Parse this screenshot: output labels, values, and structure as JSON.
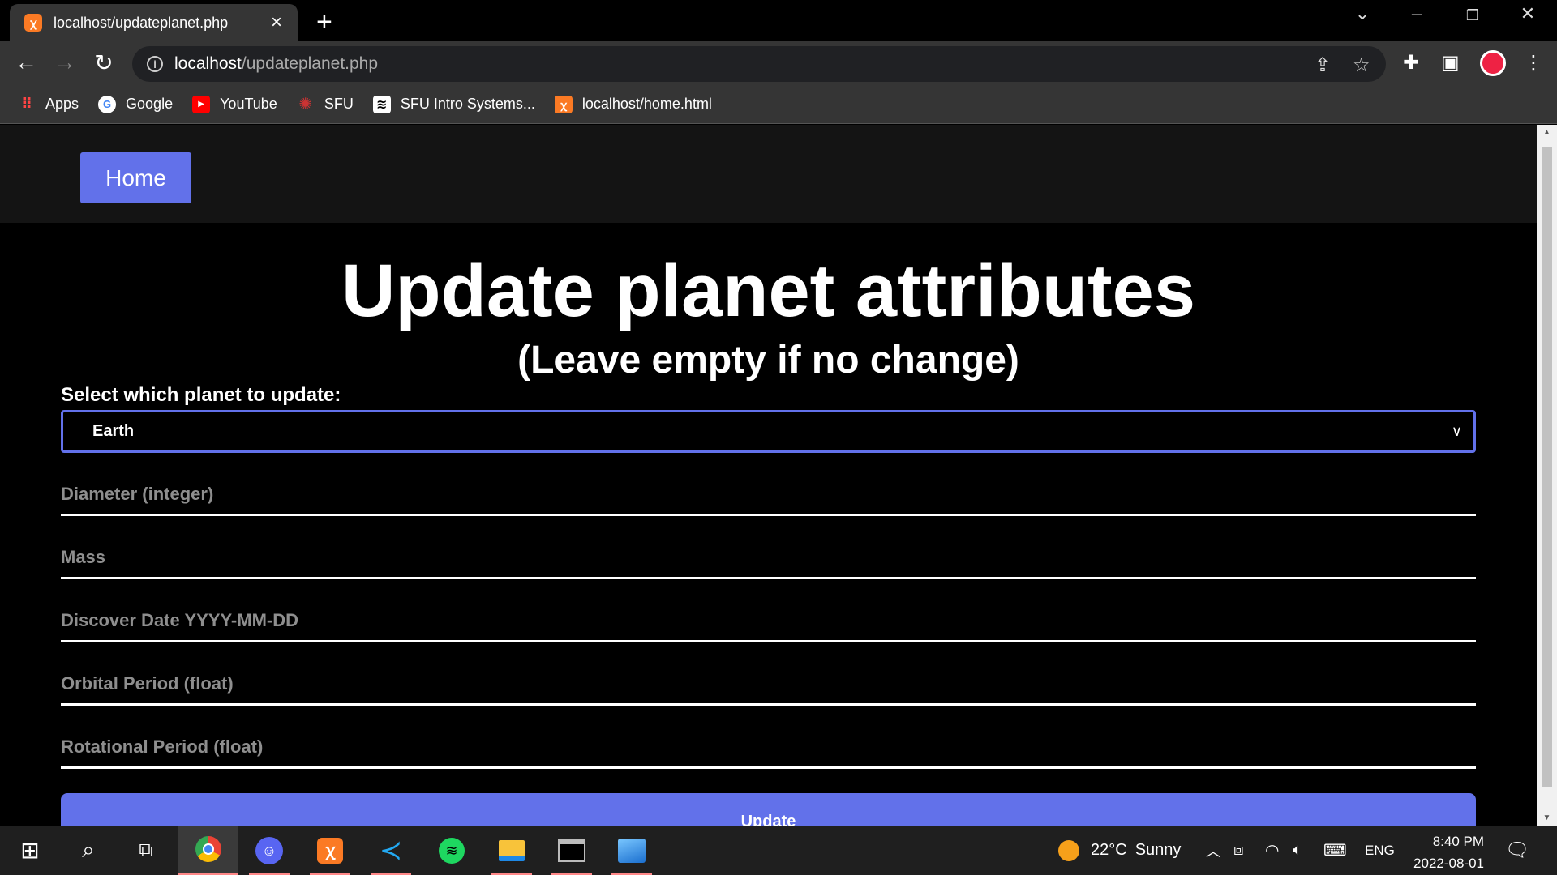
{
  "browser": {
    "tab_title": "localhost/updateplanet.php",
    "url_host": "localhost",
    "url_path": "/updateplanet.php",
    "bookmarks": [
      {
        "label": "Apps",
        "icon": "apps-grid-icon"
      },
      {
        "label": "Google",
        "icon": "google-icon"
      },
      {
        "label": "YouTube",
        "icon": "youtube-icon"
      },
      {
        "label": "SFU",
        "icon": "sfu-icon"
      },
      {
        "label": "SFU Intro Systems...",
        "icon": "sfu-intro-icon"
      },
      {
        "label": "localhost/home.html",
        "icon": "xampp-icon"
      }
    ]
  },
  "page": {
    "home_label": "Home",
    "title": "Update planet attributes",
    "subtitle": "(Leave empty if no change)",
    "select_label": "Select which planet to update:",
    "selected_planet": "Earth",
    "fields": {
      "diameter": "Diameter (integer)",
      "mass": "Mass",
      "discover_date": "Discover Date YYYY-MM-DD",
      "orbital_period": "Orbital Period (float)",
      "rotational_period": "Rotational Period (float)"
    },
    "submit_label": "Update",
    "accent_color": "#6271ea"
  },
  "taskbar": {
    "weather_temp": "22°C",
    "weather_text": "Sunny",
    "language": "ENG",
    "time": "8:40 PM",
    "date": "2022-08-01"
  }
}
